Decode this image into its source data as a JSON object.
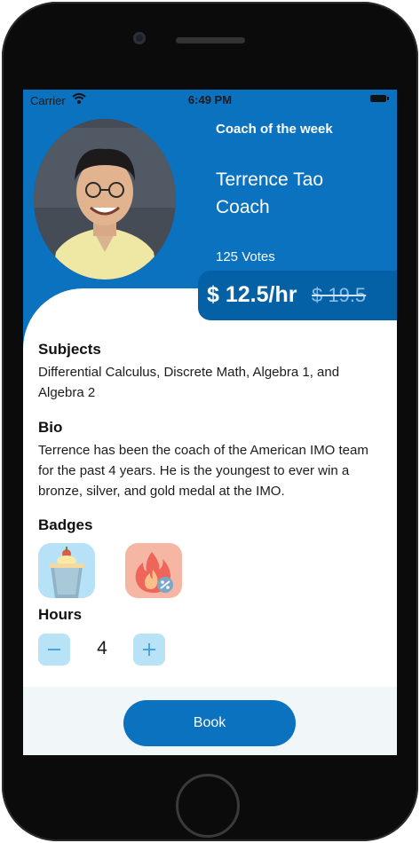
{
  "status_bar": {
    "carrier": "Carrier",
    "time": "6:49 PM"
  },
  "coach": {
    "label": "Coach of the week",
    "name": "Terrence Tao",
    "role": "Coach",
    "votes": "125 Votes",
    "price": "$ 12.5/hr",
    "old_price": "$ 19.5"
  },
  "subjects": {
    "title": "Subjects",
    "text": "Differential Calculus, Discrete Math, Algebra 1, and Algebra 2"
  },
  "bio": {
    "title": "Bio",
    "text": "Terrence has been the coach of the American IMO team for the past 4 years. He is the youngest to ever win a bronze, silver, and gold medal at the IMO."
  },
  "badges": {
    "title": "Badges",
    "items": [
      "milkshake-badge",
      "fire-badge"
    ]
  },
  "hours": {
    "title": "Hours",
    "value": "4"
  },
  "book_label": "Book",
  "colors": {
    "primary": "#0b72c0",
    "price_pill": "#0561a6",
    "light_blue": "#b8e3f7",
    "badge_orange": "#f6b6a4",
    "footer_bg": "#f1f6f9"
  }
}
